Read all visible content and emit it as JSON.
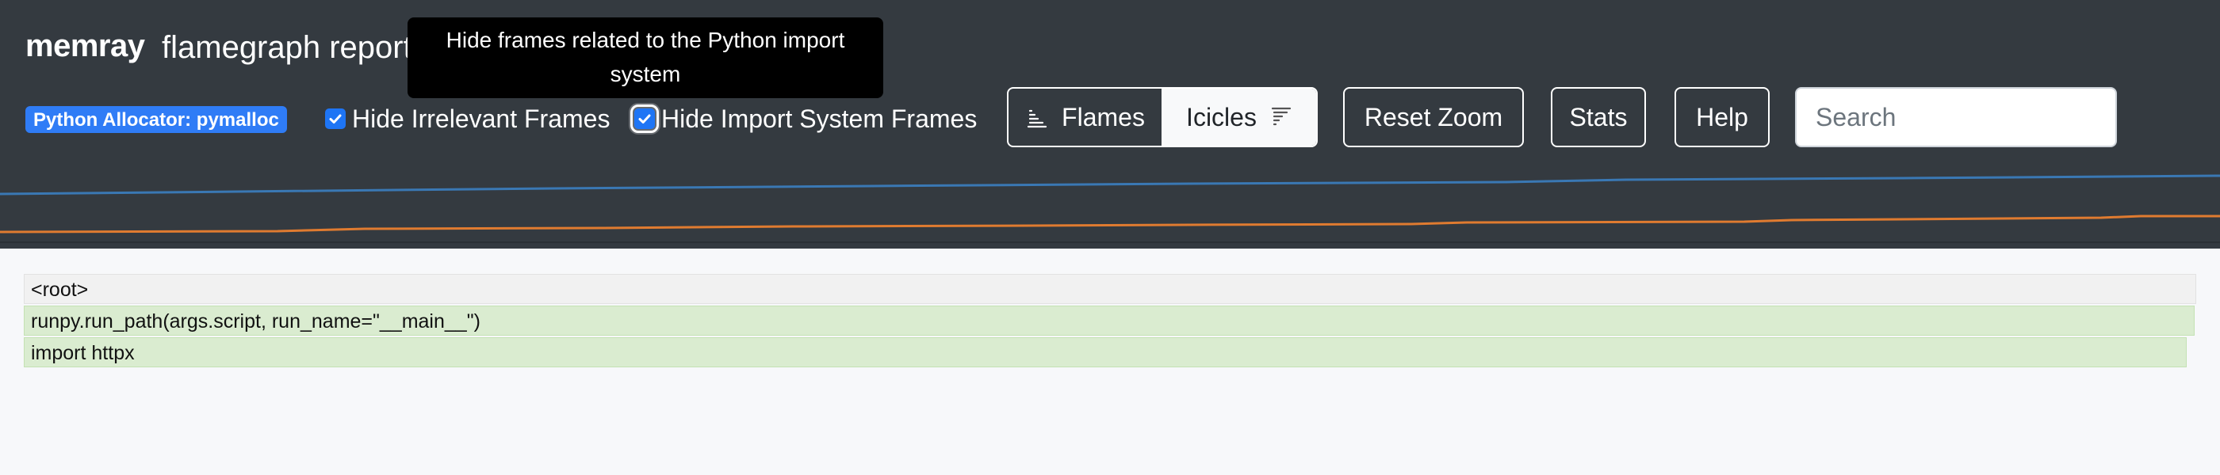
{
  "header": {
    "brand": "memray",
    "subtitle": "flamegraph report",
    "tooltip": "Hide frames related to the Python import system",
    "allocator_badge": "Python Allocator: pymalloc",
    "hide_irrelevant": {
      "label": "Hide Irrelevant Frames",
      "checked": true
    },
    "hide_import": {
      "label": "Hide Import System Frames",
      "checked": true
    },
    "view_toggle": {
      "flames": {
        "label": "Flames",
        "icon": "flames-icon"
      },
      "icicles": {
        "label": "Icicles",
        "icon": "icicles-icon",
        "active": true
      }
    },
    "buttons": {
      "reset_zoom": "Reset Zoom",
      "stats": "Stats",
      "help": "Help"
    },
    "search": {
      "placeholder": "Search",
      "value": ""
    }
  },
  "memory_chart": {
    "series": [
      {
        "color": "#3a78b4"
      },
      {
        "color": "#e07b30"
      }
    ]
  },
  "flamegraph": {
    "frames": [
      {
        "label": "<root>",
        "depth": 0
      },
      {
        "label": "runpy.run_path(args.script, run_name=\"__main__\")",
        "depth": 1
      },
      {
        "label": "import httpx",
        "depth": 2
      }
    ]
  },
  "colors": {
    "header_bg": "#343a40",
    "badge_bg": "#2f7cf6",
    "checkbox": "#1e75f5",
    "frame_root": "#f1f1f1",
    "frame_green": "#daecd0"
  }
}
